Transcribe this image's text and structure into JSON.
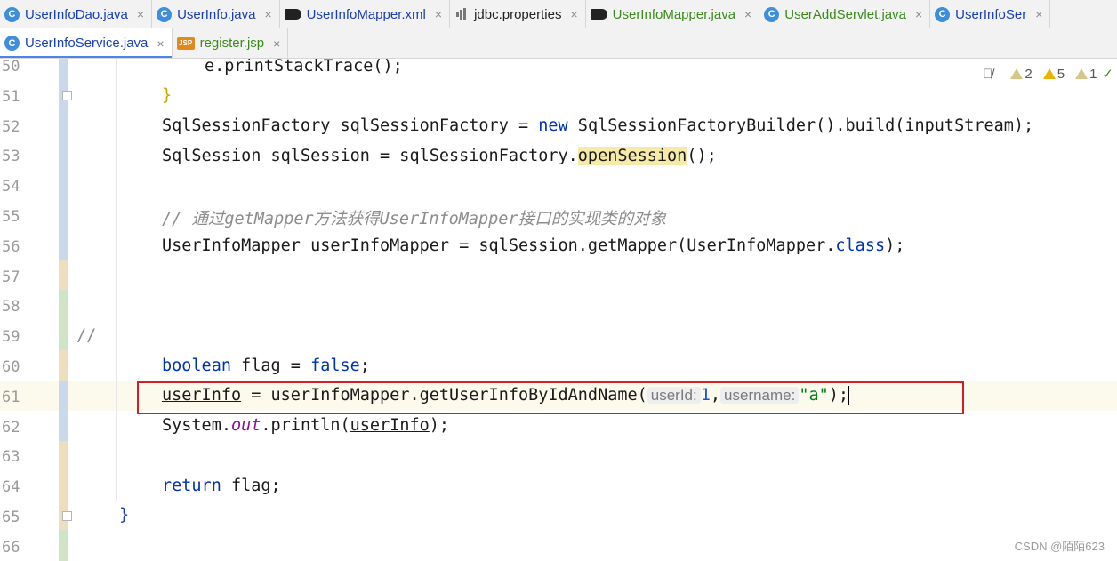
{
  "tabs_row1": [
    {
      "label": "UserInfoDao.java",
      "icon": "java-class-icon",
      "style": "blue"
    },
    {
      "label": "UserInfo.java",
      "icon": "java-class-icon",
      "style": "blue"
    },
    {
      "label": "UserInfoMapper.xml",
      "icon": "mybatis-bird-icon",
      "style": "blue"
    },
    {
      "label": "jdbc.properties",
      "icon": "properties-file-icon",
      "style": "plain"
    },
    {
      "label": "UserInfoMapper.java",
      "icon": "mybatis-bird-icon",
      "style": "green"
    },
    {
      "label": "UserAddServlet.java",
      "icon": "java-class-icon",
      "style": "green"
    },
    {
      "label": "UserInfoSer",
      "icon": "java-class-icon",
      "style": "blue"
    }
  ],
  "tabs_row2": [
    {
      "label": "UserInfoService.java",
      "icon": "java-class-icon",
      "style": "blue",
      "active": true
    },
    {
      "label": "register.jsp",
      "icon": "jsp-file-icon",
      "style": "green",
      "active": false
    }
  ],
  "icon_glyphs": {
    "java_class": "C",
    "jsp": "JSP",
    "close": "×"
  },
  "inspections": {
    "weak_warnings": "2",
    "warnings": "5",
    "typos": "1"
  },
  "line_numbers": [
    "50",
    "51",
    "52",
    "53",
    "54",
    "55",
    "56",
    "57",
    "58",
    "59",
    "60",
    "61",
    "62",
    "63",
    "64",
    "65",
    "66"
  ],
  "code": {
    "l50": {
      "a": "e.printStackTrace",
      "b": "();"
    },
    "l51": {
      "a": "}"
    },
    "l52": {
      "a": "SqlSessionFactory sqlSessionFactory = ",
      "kw": "new",
      "b": " SqlSessionFactoryBuilder().build(",
      "ul": "inputStream",
      "c": ");"
    },
    "l53": {
      "a": "SqlSession sqlSession = sqlSessionFactory.",
      "hl": "openSession",
      "b": "();"
    },
    "l55": {
      "comment": "// 通过getMapper方法获得UserInfoMapper接口的实现类的对象"
    },
    "l56": {
      "a": "UserInfoMapper userInfoMapper = sqlSession.getMapper(UserInfoMapper.",
      "kw": "class",
      "b": ");"
    },
    "l59": {
      "comment": "//"
    },
    "l60": {
      "kw": "boolean",
      "a": " flag = ",
      "kw2": "false",
      "b": ";"
    },
    "l61": {
      "ul": "userInfo",
      "a": " = userInfoMapper.getUserInfoByIdAndName(",
      "hint1": "userId:",
      "num": "1",
      "b": ",",
      "hint2": "username:",
      "str": "\"a\"",
      "c": ");"
    },
    "l62": {
      "a": "System.",
      "it": "out",
      "b": ".println(",
      "ul": "userInfo",
      "c": ");"
    },
    "l64": {
      "kw": "return",
      "a": " flag;"
    },
    "l65": {
      "a": "}"
    }
  },
  "colors": {
    "change_modified": "#c9d8ea",
    "change_added": "#cfe3c9",
    "change_other": "#eedec0",
    "highlight_box": "#d21f26"
  },
  "watermark": "CSDN @陌陌623"
}
